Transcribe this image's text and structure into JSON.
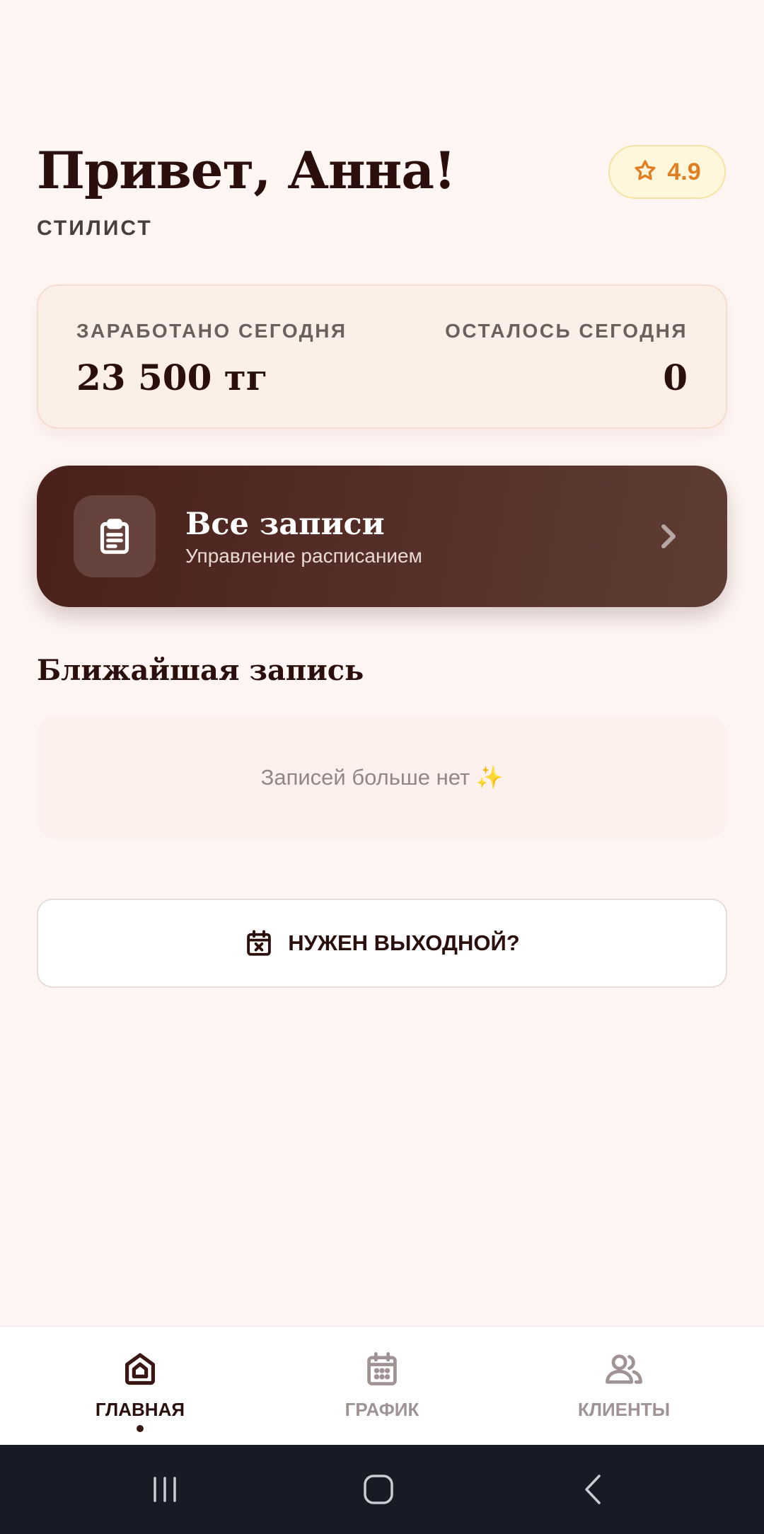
{
  "header": {
    "greeting": "Привет, Анна!",
    "role": "СТИЛИСТ",
    "rating": "4.9",
    "rating_icon": "star-icon"
  },
  "stats": {
    "earned_label": "ЗАРАБОТАНО СЕГОДНЯ",
    "earned_value": "23 500 тг",
    "remaining_label": "ОСТАЛОСЬ СЕГОДНЯ",
    "remaining_value": "0"
  },
  "all_records": {
    "title": "Все записи",
    "subtitle": "Управление расписанием",
    "icon": "clipboard-icon"
  },
  "next_booking": {
    "section_title": "Ближайшая запись",
    "empty_text": "Записей больше нет ✨"
  },
  "day_off": {
    "label": "НУЖЕН ВЫХОДНОЙ?",
    "icon": "calendar-x-icon"
  },
  "nav": {
    "items": [
      {
        "label": "ГЛАВНАЯ",
        "icon": "home-icon",
        "active": true
      },
      {
        "label": "ГРАФИК",
        "icon": "calendar-icon",
        "active": false
      },
      {
        "label": "КЛИЕНТЫ",
        "icon": "users-icon",
        "active": false
      }
    ]
  },
  "colors": {
    "background": "#fff6f4",
    "primary_dark": "#4a201a",
    "rating_accent": "#e07f22",
    "muted_text": "#9f9493"
  }
}
